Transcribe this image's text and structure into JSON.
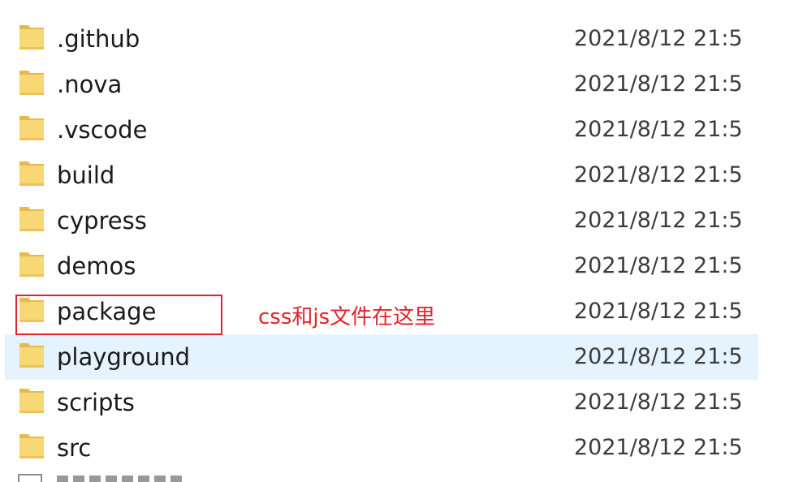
{
  "files": [
    {
      "name": ".github",
      "modified": "2021/8/12 21:5",
      "icon": "folder-icon"
    },
    {
      "name": ".nova",
      "modified": "2021/8/12 21:5",
      "icon": "folder-icon"
    },
    {
      "name": ".vscode",
      "modified": "2021/8/12 21:5",
      "icon": "folder-icon"
    },
    {
      "name": "build",
      "modified": "2021/8/12 21:5",
      "icon": "folder-icon"
    },
    {
      "name": "cypress",
      "modified": "2021/8/12 21:5",
      "icon": "folder-icon"
    },
    {
      "name": "demos",
      "modified": "2021/8/12 21:5",
      "icon": "folder-icon"
    },
    {
      "name": "package",
      "modified": "2021/8/12 21:5",
      "icon": "folder-icon"
    },
    {
      "name": "playground",
      "modified": "2021/8/12 21:5",
      "icon": "folder-icon"
    },
    {
      "name": "scripts",
      "modified": "2021/8/12 21:5",
      "icon": "folder-icon"
    },
    {
      "name": "src",
      "modified": "2021/8/12 21:5",
      "icon": "folder-icon"
    }
  ],
  "annotation": {
    "text": "css和js文件在这里",
    "color": "#e0242b"
  },
  "colors": {
    "hover_row": "#e5f3ff",
    "folder_body": "#f8d775",
    "folder_tab": "#e8b94a"
  }
}
